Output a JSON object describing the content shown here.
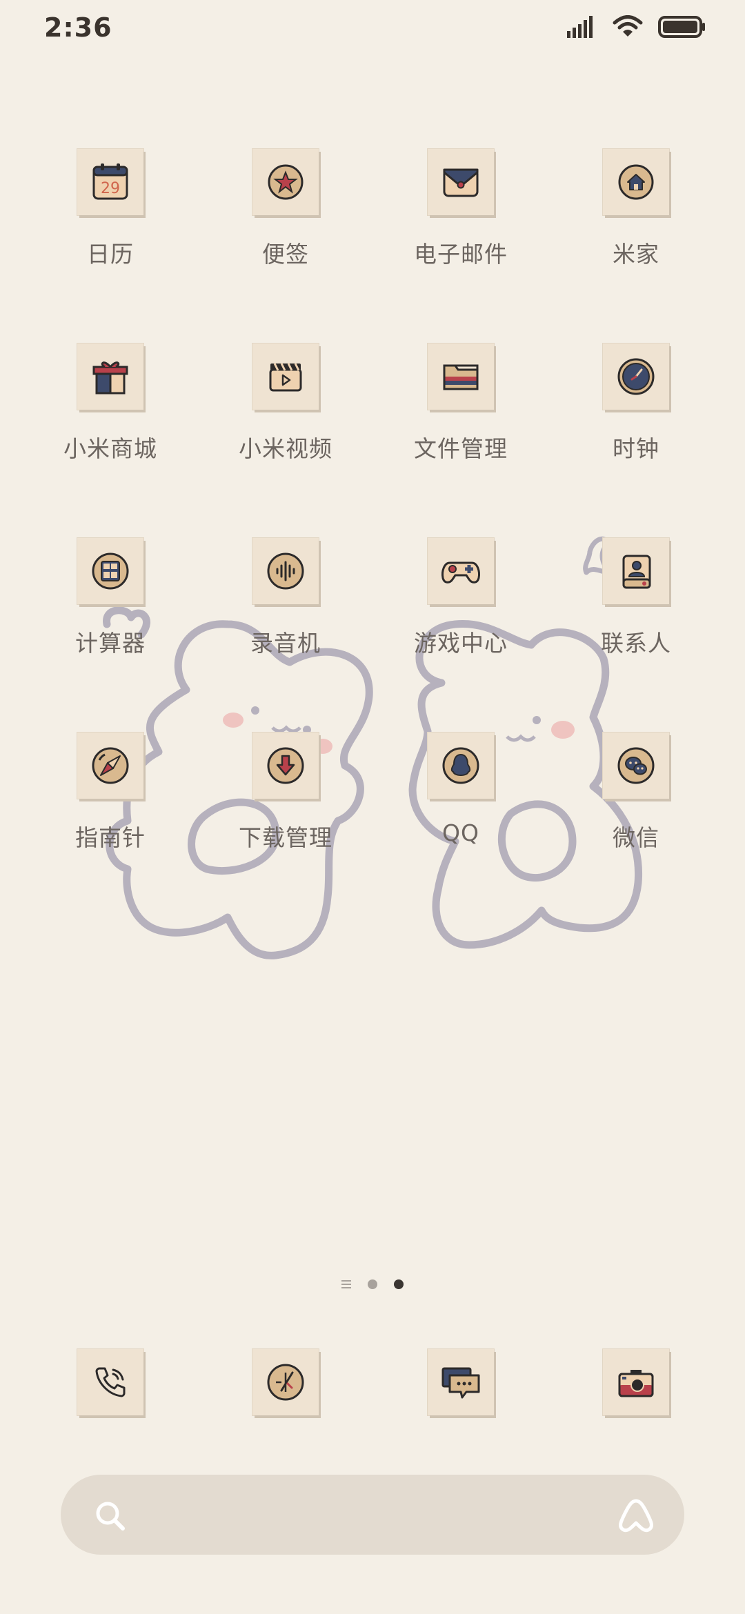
{
  "status_bar": {
    "time": "2:36",
    "icons": [
      "signal-icon",
      "wifi-icon",
      "battery-icon"
    ]
  },
  "home": {
    "apps": [
      {
        "label": "日历",
        "icon": "calendar-icon",
        "badge_text": "29"
      },
      {
        "label": "便签",
        "icon": "notes-icon"
      },
      {
        "label": "电子邮件",
        "icon": "email-icon"
      },
      {
        "label": "米家",
        "icon": "home-icon"
      },
      {
        "label": "小米商城",
        "icon": "gift-icon"
      },
      {
        "label": "小米视频",
        "icon": "video-icon"
      },
      {
        "label": "文件管理",
        "icon": "folder-icon"
      },
      {
        "label": "时钟",
        "icon": "clock-icon"
      },
      {
        "label": "计算器",
        "icon": "calculator-icon"
      },
      {
        "label": "录音机",
        "icon": "recorder-icon"
      },
      {
        "label": "游戏中心",
        "icon": "gamepad-icon"
      },
      {
        "label": "联系人",
        "icon": "contacts-icon"
      },
      {
        "label": "指南针",
        "icon": "compass-icon"
      },
      {
        "label": "下载管理",
        "icon": "download-icon"
      },
      {
        "label": "QQ",
        "icon": "qq-icon"
      },
      {
        "label": "微信",
        "icon": "wechat-icon"
      }
    ]
  },
  "page_indicator": {
    "pages": 3,
    "current": 3
  },
  "dock": {
    "apps": [
      {
        "icon": "phone-icon"
      },
      {
        "icon": "browser-icon"
      },
      {
        "icon": "messages-icon"
      },
      {
        "icon": "camera-icon"
      }
    ]
  },
  "search_bar": {
    "icons": [
      "search-icon",
      "assistant-icon"
    ]
  },
  "colors": {
    "background": "#f4efe6",
    "tile": "#efe3d2",
    "label": "#6c6560",
    "navy": "#3d4a6b",
    "red": "#b9414b",
    "tan": "#d9b98f",
    "bear_outline": "#b6b1bd",
    "blush": "#efc4c0"
  }
}
